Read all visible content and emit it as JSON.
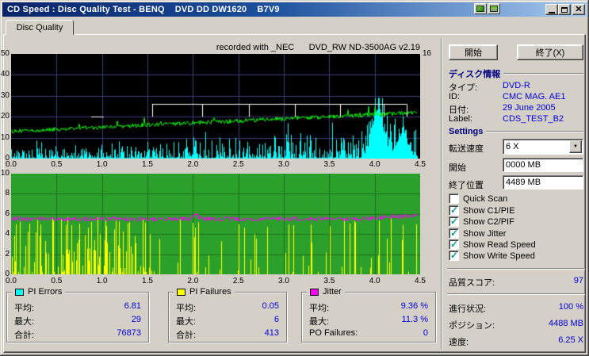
{
  "window": {
    "title": "CD Speed : Disc Quality Test - BENQ    DVD DD DW1620    B7V9"
  },
  "tab": {
    "label": "Disc Quality"
  },
  "buttons": {
    "start": "開始",
    "exit": "終了(X)"
  },
  "disc_info": {
    "header": "ディスク情報",
    "type_label": "タイプ:",
    "type_value": "DVD-R",
    "id_label": "ID:",
    "id_value": "CMC MAG. AE1",
    "date_label": "日付:",
    "date_value": "29 June 2005",
    "label_label": "Label:",
    "label_value": "CDS_TEST_B2"
  },
  "settings": {
    "header": "Settings",
    "speed_label": "転送速度",
    "speed_value": "6 X",
    "start_label": "開始",
    "start_value": "0000 MB",
    "end_label": "終了位置",
    "end_value": "4489 MB",
    "checkboxes": [
      {
        "label": "Quick Scan",
        "checked": false
      },
      {
        "label": "Show C1/PIE",
        "checked": true
      },
      {
        "label": "Show C2/PIF",
        "checked": true
      },
      {
        "label": "Show Jitter",
        "checked": true
      },
      {
        "label": "Show Read Speed",
        "checked": true
      },
      {
        "label": "Show Write Speed",
        "checked": true
      }
    ]
  },
  "score": {
    "label": "品質スコア:",
    "value": "97"
  },
  "progress": {
    "progress_label": "進行状況:",
    "progress_value": "100 %",
    "position_label": "ポジション:",
    "position_value": "4488 MB",
    "speed_label": "速度:",
    "speed_value": "6.25 X"
  },
  "stats": {
    "pi_errors": {
      "title": "PI Errors",
      "color": "#00ffff",
      "rows": [
        [
          "平均:",
          "6.81"
        ],
        [
          "最大:",
          "29"
        ],
        [
          "合計:",
          "76873"
        ]
      ]
    },
    "pi_failures": {
      "title": "PI Failures",
      "color": "#ffff00",
      "rows": [
        [
          "平均:",
          "0.05"
        ],
        [
          "最大:",
          "6"
        ],
        [
          "合計:",
          "413"
        ]
      ]
    },
    "jitter": {
      "title": "Jitter",
      "color": "#ff00ff",
      "rows": [
        [
          "平均:",
          "9.36 %"
        ],
        [
          "最大:",
          "11.3 %"
        ],
        [
          "PO Failures:",
          "0"
        ]
      ]
    }
  },
  "chart_data": [
    {
      "type": "area",
      "title": "recorded with _NEC      DVD_RW ND-3500AG v2.19",
      "x_ticks": [
        "0.0",
        "0.5",
        "1.0",
        "1.5",
        "2.0",
        "2.5",
        "3.0",
        "3.5",
        "4.0",
        "4.5"
      ],
      "xlim": [
        0,
        4.5
      ],
      "ylim": [
        0,
        50
      ],
      "y_ticks": [
        "0",
        "10",
        "20",
        "30",
        "40",
        "50"
      ],
      "right_axis_label": "16",
      "background": "#000000",
      "grid_color": "#3c3c7a",
      "data_end_x": 4.47,
      "series": [
        {
          "name": "PI Errors",
          "color": "#00ffff",
          "style": "noise-area",
          "avg": 6.81,
          "max": 29,
          "peak_x": 4.03
        },
        {
          "name": "Read Speed",
          "color": "#00ff00",
          "style": "noisy-rising-line",
          "start_y": 13,
          "end_y": 22
        },
        {
          "name": "Write Speed",
          "color": "#ffffff",
          "style": "step-line",
          "high": 26,
          "low": 20,
          "start_x": 1.55,
          "end_x": 4.35,
          "drops": [
            2.1,
            2.62,
            3.12,
            3.62,
            4.1
          ],
          "pre_segment": [
            0.88,
            1.02
          ]
        }
      ]
    },
    {
      "type": "bar+line",
      "x_ticks": [
        "0.0",
        "0.5",
        "1.0",
        "1.5",
        "2.0",
        "2.5",
        "3.0",
        "3.5",
        "4.0",
        "4.5"
      ],
      "xlim": [
        0,
        4.5
      ],
      "ylim": [
        0,
        10
      ],
      "y_ticks": [
        "0",
        "2",
        "4",
        "6",
        "8",
        "10"
      ],
      "background": "#2ba02b",
      "grid_color": "#1e6f1e",
      "data_end_x": 4.47,
      "series": [
        {
          "name": "PI Failures",
          "color": "#ffff00",
          "style": "spikes",
          "avg": 0.05,
          "max": 6,
          "dense_until_x": 1.55,
          "tall_spikes": [
            0.05,
            0.1,
            0.2,
            0.32,
            0.45,
            0.55,
            0.62,
            0.75,
            0.85,
            0.95,
            1.05,
            1.15,
            1.3,
            1.45,
            2.0,
            2.06,
            2.5,
            2.56,
            3.3,
            3.66,
            3.72,
            3.78,
            4.05,
            4.18
          ]
        },
        {
          "name": "Jitter",
          "color": "#ff00ff",
          "style": "noisy-line",
          "avg_y": 5.5,
          "bump_x": 2.03,
          "end_rise": 0.5
        }
      ]
    }
  ]
}
